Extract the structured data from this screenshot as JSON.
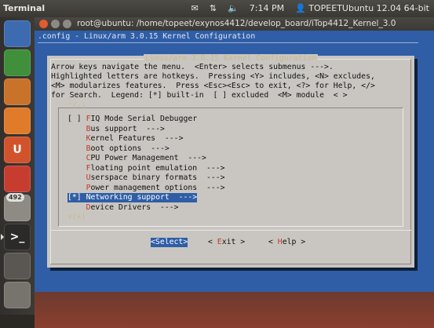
{
  "top_panel": {
    "app_title": "Terminal",
    "net_icon": "network-icon",
    "volume_icon": "volume-icon",
    "time": "7:14 PM",
    "user": "TOPEETUbuntu 12.04 64-bit"
  },
  "launcher": {
    "items": [
      {
        "name": "files-icon",
        "color": "#3c6bb0"
      },
      {
        "name": "calc-icon",
        "color": "#3f8f3b"
      },
      {
        "name": "impress-icon",
        "color": "#c8722a"
      },
      {
        "name": "software-center-icon",
        "color": "#e07b2a"
      },
      {
        "name": "ubuntu-one-icon",
        "color": "#d1532c",
        "glyph": "U"
      },
      {
        "name": "settings-icon",
        "color": "#c63d30"
      },
      {
        "name": "update-manager-icon",
        "color": "#8e8a84",
        "badge": "492"
      },
      {
        "name": "terminal-icon",
        "color": "#2b2a28",
        "glyph": ">_"
      },
      {
        "name": "workspace-icon",
        "color": "#5a5753"
      },
      {
        "name": "trash-icon",
        "color": "#77736d"
      }
    ]
  },
  "window": {
    "title": "root@ubuntu: /home/topeet/exynos4412/develop_board/iTop4412_Kernel_3.0"
  },
  "terminal": {
    "header": ".config - Linux/arm 3.0.15 Kernel Configuration",
    "dialog_title": "Linux/arm 3.0.15 Kernel Configuration",
    "help_lines": [
      "Arrow keys navigate the menu.  <Enter> selects submenus --->.",
      "Highlighted letters are hotkeys.  Pressing <Y> includes, <N> excludes,",
      "<M> modularizes features.  Press <Esc><Esc> to exit, <?> for Help, </>",
      "for Search.  Legend: [*] built-in  [ ] excluded  <M> module  < >"
    ],
    "scroll_up": "^(-)",
    "scroll_down": "v(+)",
    "menu_items": [
      {
        "prefix": "[ ] ",
        "hotkey": "F",
        "rest": "IQ Mode Serial Debugger",
        "selected": false
      },
      {
        "prefix": "    ",
        "hotkey": "B",
        "rest": "us support  --->",
        "selected": false
      },
      {
        "prefix": "    ",
        "hotkey": "K",
        "rest": "ernel Features  --->",
        "selected": false
      },
      {
        "prefix": "    ",
        "hotkey": "B",
        "rest": "oot options  --->",
        "selected": false
      },
      {
        "prefix": "    ",
        "hotkey": "C",
        "rest": "PU Power Management  --->",
        "selected": false
      },
      {
        "prefix": "    ",
        "hotkey": "F",
        "rest": "loating point emulation  --->",
        "selected": false
      },
      {
        "prefix": "    ",
        "hotkey": "U",
        "rest": "serspace binary formats  --->",
        "selected": false
      },
      {
        "prefix": "    ",
        "hotkey": "P",
        "rest": "ower management options  --->",
        "selected": false
      },
      {
        "prefix": "[*] ",
        "hotkey": "N",
        "rest": "etworking support  --->",
        "selected": true
      },
      {
        "prefix": "    ",
        "hotkey": "D",
        "rest": "evice Drivers  --->",
        "selected": false
      }
    ],
    "buttons": [
      {
        "lead": "<",
        "hotkey": "S",
        "rest": "elect>",
        "selected": true
      },
      {
        "lead": "< ",
        "hotkey": "E",
        "rest": "xit >",
        "selected": false
      },
      {
        "lead": "< ",
        "hotkey": "H",
        "rest": "elp >",
        "selected": false
      }
    ]
  }
}
